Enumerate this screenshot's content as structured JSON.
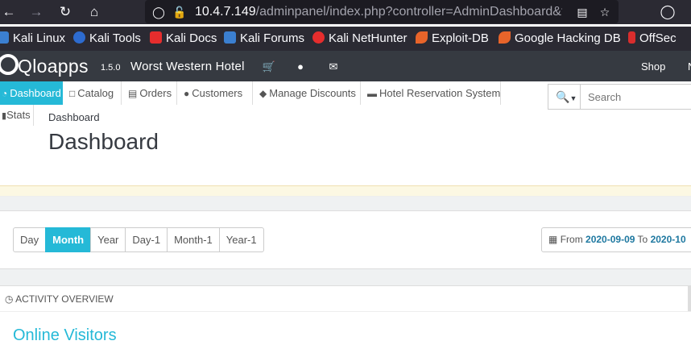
{
  "browser": {
    "url_host": "10.4.7.149",
    "url_path": "/adminpanel/index.php?controller=AdminDashboard&tok",
    "icons": [
      "back-icon",
      "forward-icon",
      "reload-icon",
      "home-icon",
      "shield-icon",
      "lock-insecure-icon",
      "reader-view-icon",
      "star-icon",
      "pocket-icon"
    ]
  },
  "bookmarks": [
    {
      "label": "Kali Linux",
      "color": "#3b7fd0"
    },
    {
      "label": "Kali Tools",
      "color": "#2d6bcf"
    },
    {
      "label": "Kali Docs",
      "color": "#e62d2d"
    },
    {
      "label": "Kali Forums",
      "color": "#3b7fd0"
    },
    {
      "label": "Kali NetHunter",
      "color": "#e62d2d"
    },
    {
      "label": "Exploit-DB",
      "color": "#e8642a"
    },
    {
      "label": "Google Hacking DB",
      "color": "#e8642a"
    },
    {
      "label": "OffSec",
      "color": "#d92d2d"
    }
  ],
  "app": {
    "logo": "Qloapps",
    "version": "1.5.0",
    "hotel_name": "Worst Western Hotel",
    "shop_label": "Shop",
    "shop_cut": "N"
  },
  "menu": [
    {
      "label": "Dashboard",
      "icon": "dashboard-icon",
      "active": true
    },
    {
      "label": "Catalog",
      "icon": "book-icon",
      "active": false
    },
    {
      "label": "Orders",
      "icon": "credit-card-icon",
      "active": false
    },
    {
      "label": "Customers",
      "icon": "users-icon",
      "active": false
    },
    {
      "label": "Manage Discounts",
      "icon": "tag-icon",
      "active": false
    },
    {
      "label": "Hotel Reservation System",
      "icon": "bed-icon",
      "active": false
    }
  ],
  "stats_label": "Stats",
  "search": {
    "placeholder": "Search"
  },
  "breadcrumb": "Dashboard",
  "page_title": "Dashboard",
  "periods": [
    {
      "label": "Day",
      "active": false
    },
    {
      "label": "Month",
      "active": true
    },
    {
      "label": "Year",
      "active": false
    },
    {
      "label": "Day-1",
      "active": false
    },
    {
      "label": "Month-1",
      "active": false
    },
    {
      "label": "Year-1",
      "active": false
    }
  ],
  "date_range": {
    "from_label": "From",
    "from": "2020-09-09",
    "to_label": "To",
    "to": "2020-10"
  },
  "activity": {
    "header": "ACTIVITY OVERVIEW",
    "title": "Online Visitors"
  },
  "colors": {
    "accent": "#25b9d7",
    "appbar": "#363a41",
    "browser": "#2b2a33"
  }
}
